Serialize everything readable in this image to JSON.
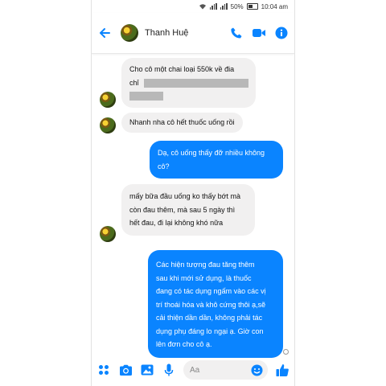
{
  "status_bar": {
    "battery": "50%",
    "time": "10:04 am"
  },
  "header": {
    "contact_name": "Thanh Huệ"
  },
  "messages": [
    {
      "side": "in",
      "lines": [
        "Cho cô một chai loại 550k về đia",
        "chỉ"
      ],
      "has_redaction": true
    },
    {
      "side": "in",
      "text": "Nhanh nha cô hết thuốc uống rồi"
    },
    {
      "side": "out",
      "lines": [
        "Dạ, cô uống thấy đỡ nhiều không",
        "cô?"
      ]
    },
    {
      "side": "in",
      "lines": [
        "mấy bữa đầu uống ko thấy bớt mà",
        "còn đau thêm, mà sau 5 ngày thì",
        "hết đau, đi lại không khó nữa"
      ]
    },
    {
      "side": "out",
      "lines": [
        "Các hiện tượng đau tăng thêm",
        "sau khi mới sử dụng, là thuốc",
        "đang có tác dụng ngấm vào các vị",
        "trí thoái hóa và khô cứng thôi ạ,sẽ",
        "cải thiện dần dần, không phải tác",
        "dụng phụ đáng lo ngại ạ. Giờ con",
        "lên đơn cho cô ạ."
      ]
    }
  ],
  "composer": {
    "placeholder": "Aa"
  },
  "colors": {
    "accent": "#0a84ff",
    "incoming_bubble": "#f1f0f0"
  },
  "icons": [
    "wifi-icon",
    "signal-icon",
    "battery-icon",
    "back-arrow-icon",
    "phone-icon",
    "video-icon",
    "info-icon",
    "apps-icon",
    "camera-icon",
    "gallery-icon",
    "microphone-icon",
    "emoji-icon",
    "thumbs-up-icon"
  ]
}
